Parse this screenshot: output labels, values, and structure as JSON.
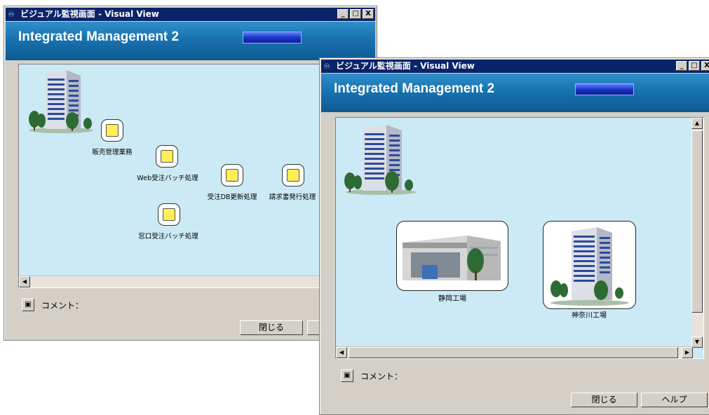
{
  "window1": {
    "title": "ビジュアル監視画面 - Visual View",
    "banner_title": "Integrated Management 2",
    "nodes": [
      {
        "label": "販売管理業務"
      },
      {
        "label": "Web受注バッチ処理"
      },
      {
        "label": "受注DB更新処理"
      },
      {
        "label": "請求書発行処理"
      },
      {
        "label": "窓口受注バッチ処理"
      }
    ],
    "comment_label": "コメント：",
    "close_button": "閉じる"
  },
  "window2": {
    "title": "ビジュアル監視画面 - Visual View",
    "banner_title": "Integrated Management 2",
    "nodes": [
      {
        "label": "静岡工場",
        "icon": "factory-icon"
      },
      {
        "label": "神奈川工場",
        "icon": "building-icon"
      }
    ],
    "comment_label": "コメント：",
    "close_button": "閉じる",
    "help_button": "ヘルプ"
  },
  "titlebar_buttons": {
    "minimize": "_",
    "maximize": "□",
    "close": "X"
  },
  "colors": {
    "titlebar": "#0a246a",
    "banner": "#1872b0",
    "canvas": "#cceaf6",
    "node_fill": "#ffee55"
  }
}
